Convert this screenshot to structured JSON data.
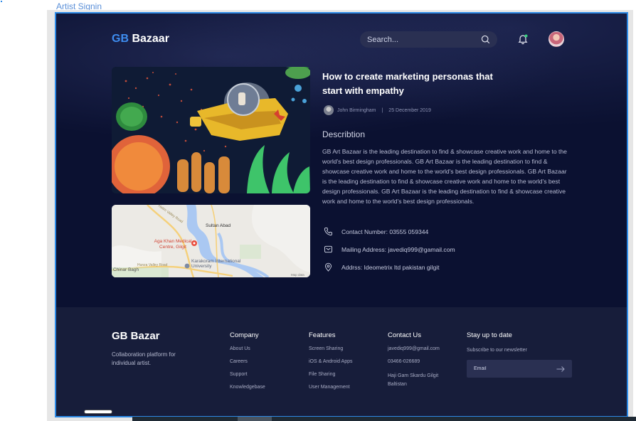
{
  "canvas_label": "Artist Signin",
  "header": {
    "brand_prefix": "GB",
    "brand_suffix": " Bazaar",
    "search_placeholder": "Search..."
  },
  "post": {
    "title": "How to create marketing personas that start with empathy",
    "author": "John Birmingham",
    "separator": "|",
    "date": "25 December 2019",
    "description_heading": "Describtion",
    "description": "GB Art Bazaar is the leading destination to find & showcase creative work and home to the world's best design professionals. GB Art Bazaar is the leading destination to find & showcase creative work and home to the world's best design professionals. GB Art Bazaar is the leading destination to find & showcase creative work and home to the world's best design professionals. GB Art Bazaar is the leading destination to find & showcase creative work and home to the world's best design professionals.",
    "contacts": [
      {
        "icon": "phone-icon",
        "text": "Contact Number: 03555 059344"
      },
      {
        "icon": "mail-icon",
        "text": "Mailing Address: javediq999@gamail.com"
      },
      {
        "icon": "location-pin-icon",
        "text": "Addrss: Ideometrix ltd pakistan gilgit"
      }
    ]
  },
  "map": {
    "labels": [
      "Sultan Abad",
      "Aga Khan Medical Centre, Gilgit",
      "Karakoram International University",
      "Chinar Bagh",
      "Hunza Valley Road",
      "Hatim Valley Road",
      "Map data"
    ]
  },
  "footer": {
    "brand": "GB Bazar",
    "tagline": "Collaboration platform for individual artist.",
    "company": {
      "heading": "Company",
      "links": [
        "About Us",
        "Careers",
        "Support",
        "Knowledgebase"
      ]
    },
    "features": {
      "heading": "Features",
      "links": [
        "Screen Sharing",
        "iOS & Android Apps",
        "File Sharing",
        "User Management"
      ]
    },
    "contact": {
      "heading": "Contact Us",
      "email": "javediq999@gmail.com",
      "phone": "03466-026689",
      "address": "Haji Gam Skardu Gilgit Baltistan"
    },
    "newsletter": {
      "heading": "Stay up to date",
      "subtitle": "Subscribe to our newsletter",
      "placeholder": "Email"
    }
  },
  "colors": {
    "accent": "#3e8df0",
    "background": "#0b1131",
    "footer": "#171d3a",
    "frame_border": "#2d8ae6"
  }
}
